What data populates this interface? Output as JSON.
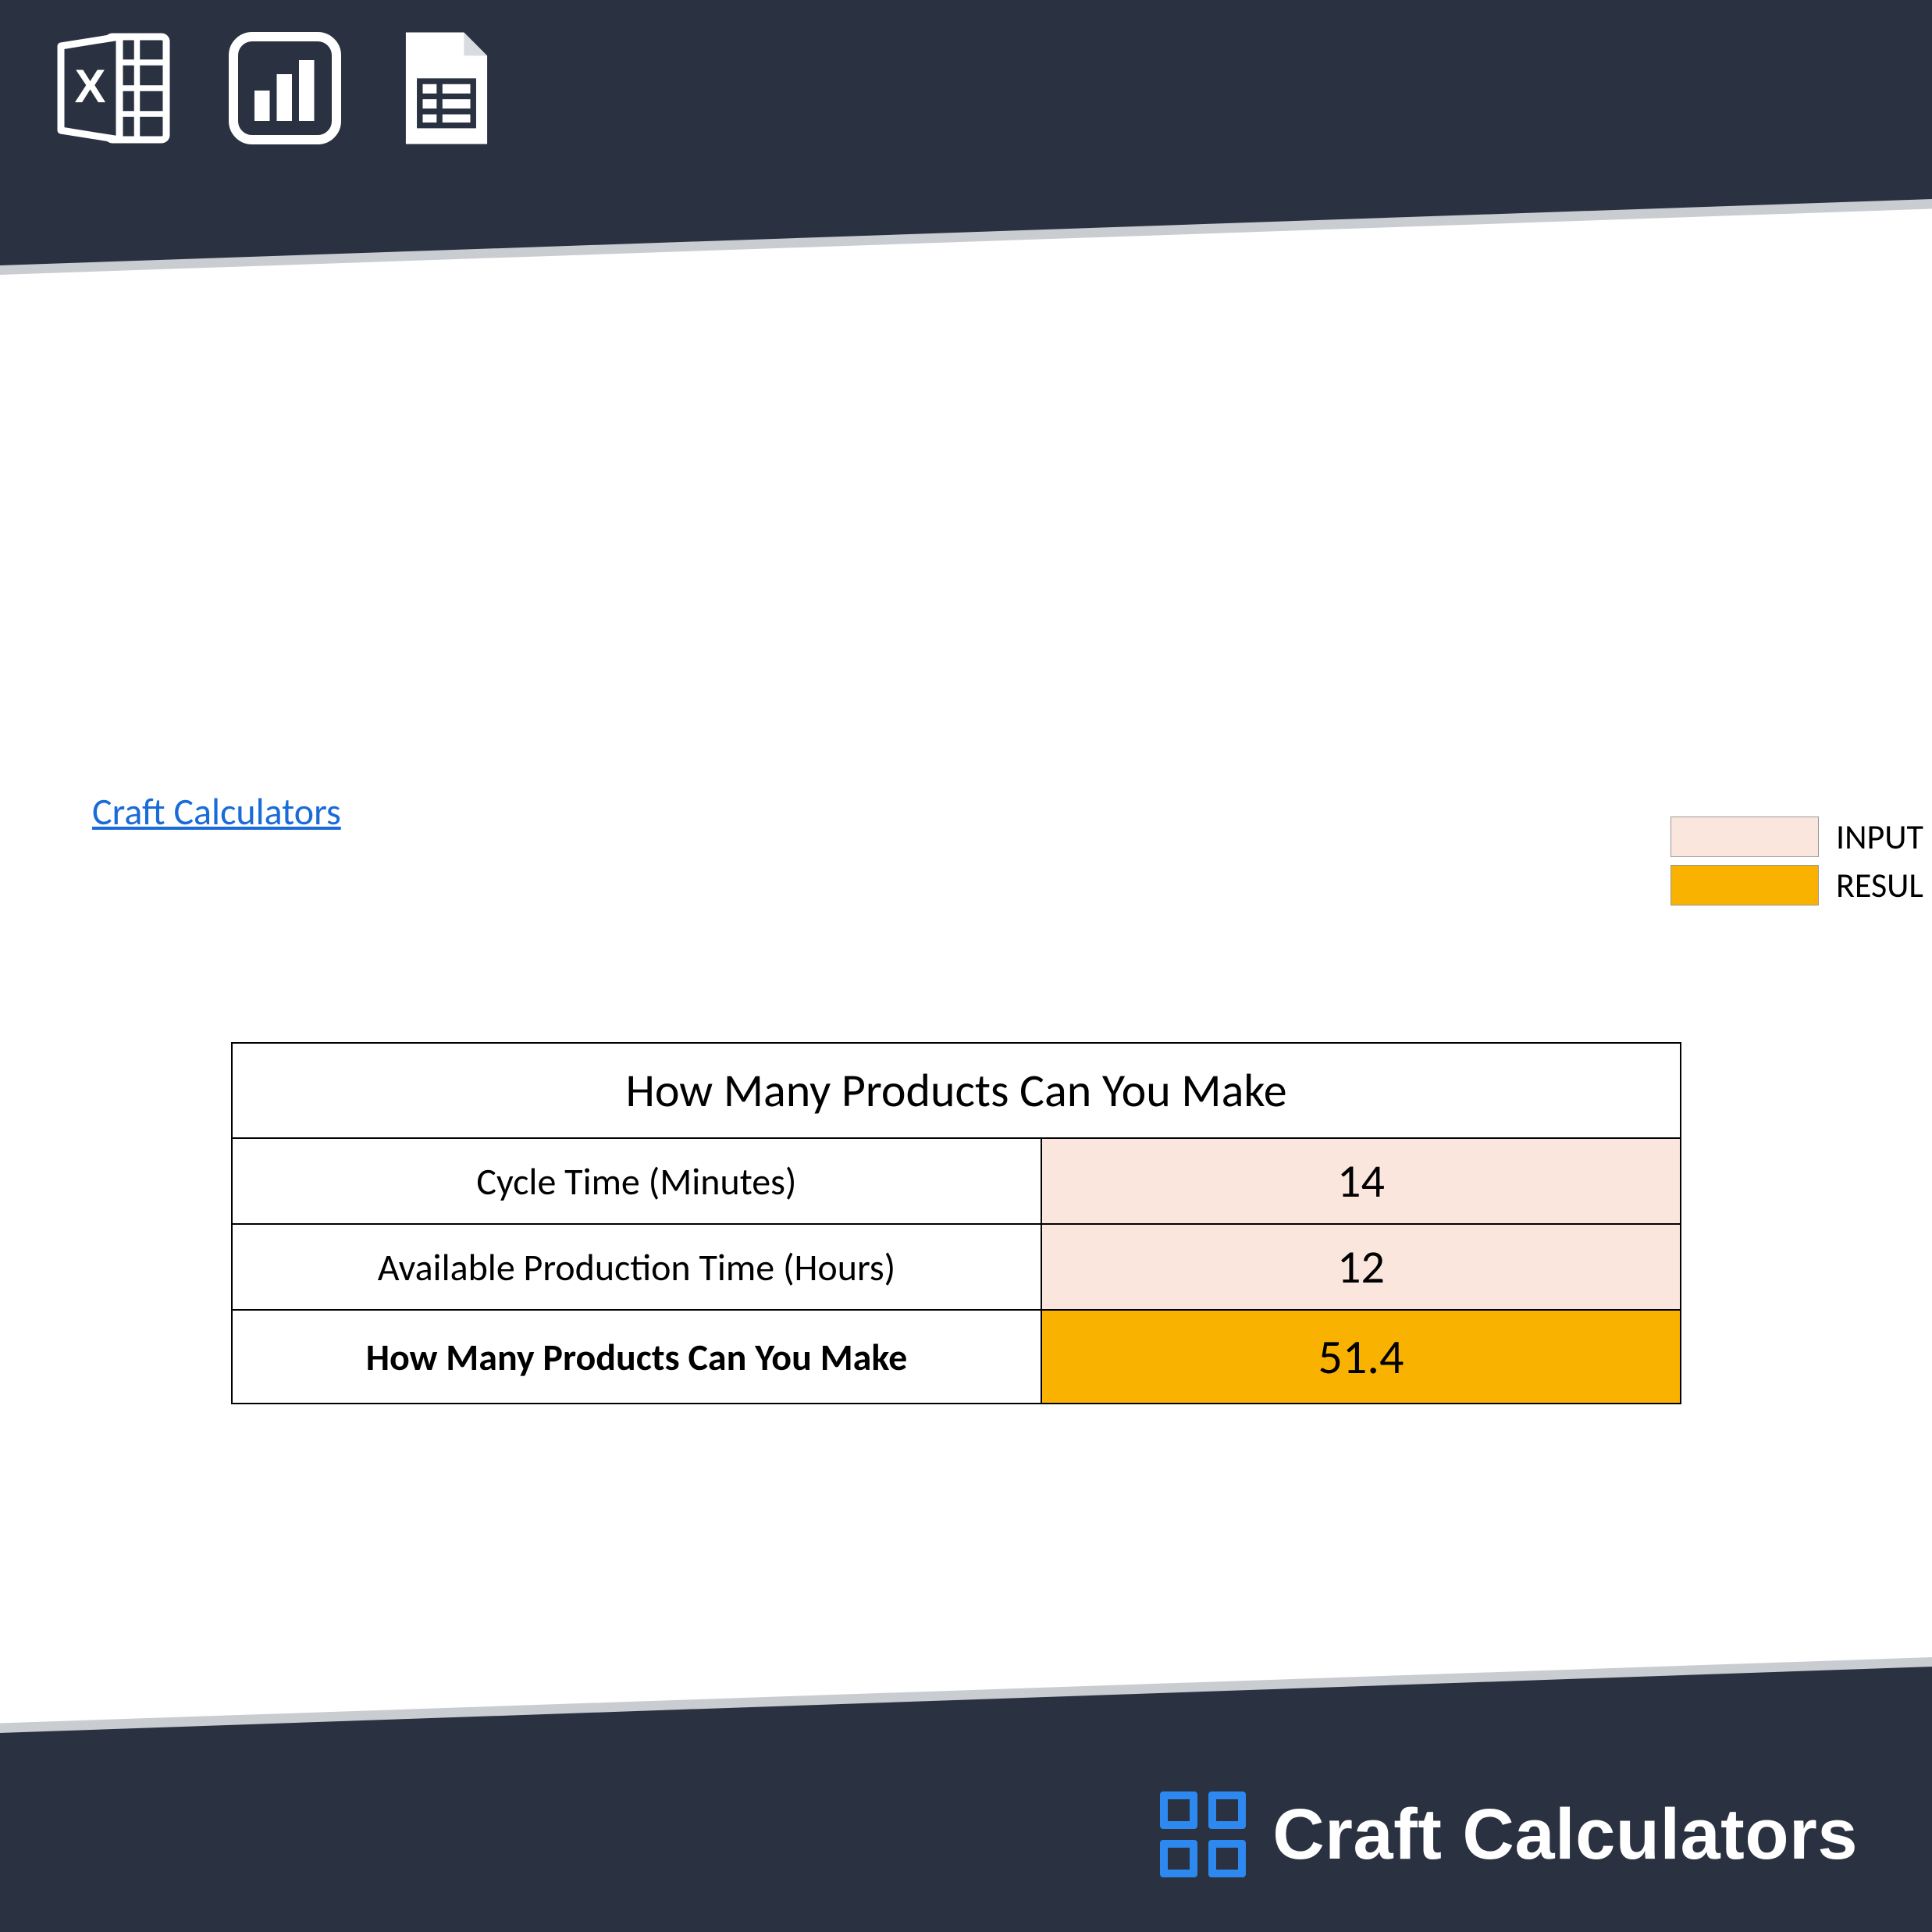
{
  "link_text": "Craft Calculators",
  "legend": {
    "input": "INPUT",
    "result": "RESUL"
  },
  "table": {
    "title": "How Many Products Can You Make",
    "rows": [
      {
        "label": "Cycle Time (Minutes)",
        "value": "14"
      },
      {
        "label": "Available Production Time (Hours)",
        "value": "12"
      }
    ],
    "result_label": "How Many Products Can You Make",
    "result_value": "51.4"
  },
  "footer_brand": "Craft Calculators",
  "colors": {
    "banner": "#2a3140",
    "input_bg": "#fbe6de",
    "result_bg": "#f9b200",
    "brand_blue": "#2d89ef"
  }
}
